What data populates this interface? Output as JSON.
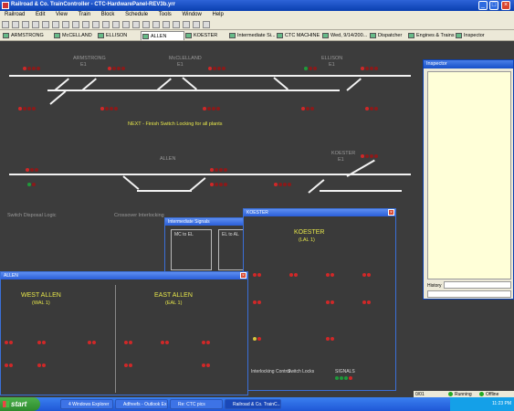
{
  "window": {
    "title": "Railroad & Co. TrainController - CTC-HardwarePanel-REV3b.yrr",
    "buttons": {
      "minimize": "_",
      "maximize": "□",
      "close": "×"
    }
  },
  "menu": [
    "Railroad",
    "Edit",
    "View",
    "Train",
    "Block",
    "Schedule",
    "Tools",
    "Window",
    "Help"
  ],
  "tabs": [
    {
      "label": "ARMSTRONG"
    },
    {
      "label": "McCELLAND"
    },
    {
      "label": "ELLISON"
    },
    {
      "label": "ALLEN"
    },
    {
      "label": "KOESTER"
    },
    {
      "label": "Intermediate Si..."
    },
    {
      "label": "CTC MACHINE"
    },
    {
      "label": "Wed, 9/14/200..."
    },
    {
      "label": "Dispatcher"
    },
    {
      "label": "Engines & Trains"
    },
    {
      "label": "Inspector"
    }
  ],
  "panel": {
    "stations": {
      "armstrong": "ARMSTRONG",
      "mcclelland": "McCLELLAND",
      "ellison": "ELLISON",
      "allen": "ALLEN",
      "koester": "KOESTER"
    },
    "station_codes": {
      "armstrong": "E1",
      "mcclelland": "E1",
      "ellison": "E1",
      "koester": "E1"
    },
    "note": "NEXT - Finish Switch Locking for all plants",
    "lower_labels": {
      "left": "Switch Disposal Logic",
      "right": "Crossover Interlocking"
    }
  },
  "inspector": {
    "title": "Inspector",
    "history_label": "History"
  },
  "windows": {
    "intermediate": {
      "title": "Intermediate Signals",
      "col1": "MC to EL",
      "col2": "EL to AL"
    },
    "koester": {
      "title": "KOESTER",
      "heading": "KOESTER",
      "subheading": "(LAL 1)",
      "bottom_left": "Interlocking Control",
      "bottom_mid": "Switch Locks",
      "bottom_right": "SIGNALS"
    },
    "allen": {
      "title": "ALLEN",
      "west": "WEST ALLEN",
      "west_sub": "(WAL 1)",
      "east": "EAST ALLEN",
      "east_sub": "(EAL 1)"
    }
  },
  "statusbar": {
    "code": "0/01",
    "running": "Running",
    "offline": "Offline"
  },
  "taskbar": {
    "start": "start",
    "items": [
      "4 Windows Explorer",
      "Adfreefs - Outlook Ex...",
      "Re: CTC pics",
      "Railroad & Co. TrainC..."
    ],
    "clock": "11:23 PM"
  }
}
